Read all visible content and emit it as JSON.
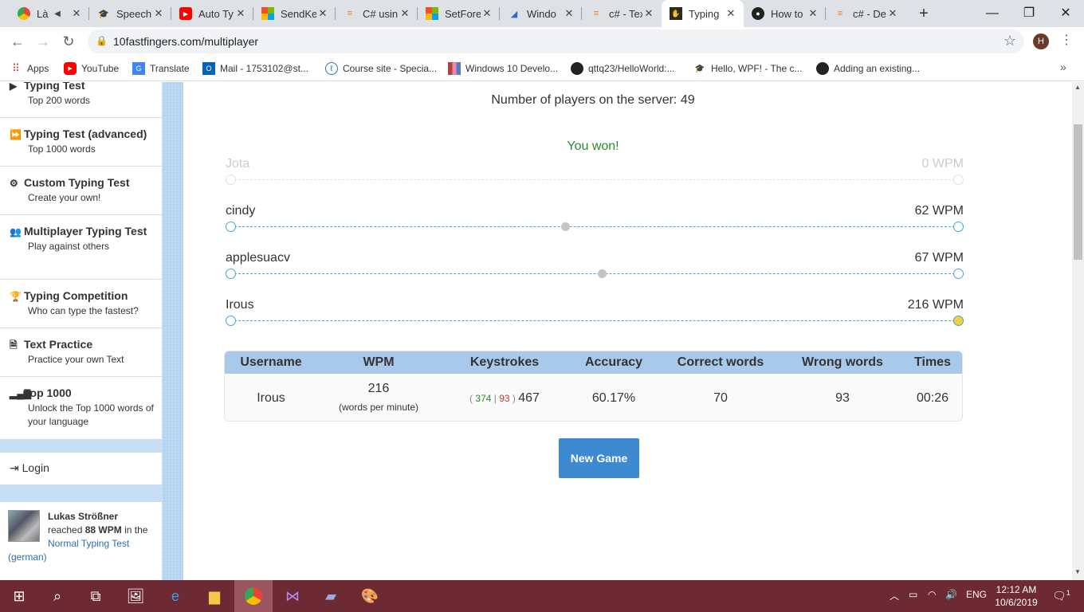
{
  "tabs": [
    {
      "title": "Là l",
      "icon": "chrome-icon",
      "active": false
    },
    {
      "title": "Speech",
      "icon": "graduation-cap-icon",
      "active": false
    },
    {
      "title": "Auto Ty",
      "icon": "youtube-icon",
      "active": false
    },
    {
      "title": "SendKe",
      "icon": "microsoft-icon",
      "active": false
    },
    {
      "title": "C# usin",
      "icon": "stackoverflow-icon",
      "active": false
    },
    {
      "title": "SetFore",
      "icon": "microsoft-icon",
      "active": false
    },
    {
      "title": "Windo",
      "icon": "visual-studio-icon",
      "active": false
    },
    {
      "title": "c# - Tex",
      "icon": "stackoverflow-icon",
      "active": false
    },
    {
      "title": "Typing",
      "icon": "10fastfingers-icon",
      "active": true
    },
    {
      "title": "How to",
      "icon": "github-icon",
      "active": false
    },
    {
      "title": "c# - De",
      "icon": "stackoverflow-icon",
      "active": false
    }
  ],
  "address": {
    "url": "10fastfingers.com/multiplayer"
  },
  "profile_initial": "H",
  "bookmarks": [
    {
      "label": "Apps",
      "icon": "apps-grid-icon"
    },
    {
      "label": "YouTube",
      "icon": "youtube-icon"
    },
    {
      "label": "Translate",
      "icon": "google-translate-icon"
    },
    {
      "label": "Mail - 1753102@st...",
      "icon": "outlook-icon"
    },
    {
      "label": "Course site - Specia...",
      "icon": "course-site-icon"
    },
    {
      "label": "Windows 10 Develo...",
      "icon": "book-icon"
    },
    {
      "label": "qttq23/HelloWorld:...",
      "icon": "github-icon"
    },
    {
      "label": "Hello, WPF! - The c...",
      "icon": "graduation-cap-icon"
    },
    {
      "label": "Adding an existing...",
      "icon": "github-icon"
    }
  ],
  "sidebar": {
    "menu": [
      {
        "title": "Typing Test",
        "sub": "Top 200 words",
        "icon": "play-icon"
      },
      {
        "title": "Typing Test (advanced)",
        "sub": "Top 1000 words",
        "icon": "fast-forward-icon"
      },
      {
        "title": "Custom Typing Test",
        "sub": "Create your own!",
        "icon": "cogs-icon"
      },
      {
        "title": "Multiplayer Typing Test",
        "sub": "Play against others",
        "icon": "users-icon"
      },
      {
        "title": "Typing Competition",
        "sub": "Who can type the fastest?",
        "icon": "trophy-icon"
      },
      {
        "title": "Text Practice",
        "sub": "Practice your own Text",
        "icon": "document-icon"
      },
      {
        "title": "Top 1000",
        "sub": "Unlock the Top 1000 words of your language",
        "icon": "bar-chart-icon"
      }
    ],
    "login": "Login",
    "news": {
      "name": "Lukas Strößner",
      "text1": "reached",
      "wpm": "88 WPM",
      "text2": "in the",
      "link": "Normal Typing Test (german)"
    }
  },
  "main": {
    "players_count": "Number of players on the server: 49",
    "result_message": "You won!",
    "racers": [
      {
        "name": "Jota",
        "wpm": "0 WPM",
        "progress": 0,
        "faded": true,
        "winner": false
      },
      {
        "name": "cindy",
        "wpm": "62 WPM",
        "progress": 0.46,
        "faded": false,
        "winner": false
      },
      {
        "name": "applesuacv",
        "wpm": "67 WPM",
        "progress": 0.51,
        "faded": false,
        "winner": false
      },
      {
        "name": "Irous",
        "wpm": "216 WPM",
        "progress": 1.0,
        "faded": false,
        "winner": true
      }
    ],
    "results_table": {
      "headers": [
        "Username",
        "WPM",
        "Keystrokes",
        "Accuracy",
        "Correct words",
        "Wrong words",
        "Times"
      ],
      "row": {
        "username": "Irous",
        "wpm": "216",
        "wpm_unit": "(words per minute)",
        "keystrokes_correct": "374",
        "keystrokes_wrong": "93",
        "keystrokes_total": "467",
        "accuracy": "60.17%",
        "correct_words": "70",
        "wrong_words": "93",
        "time": "00:26"
      }
    },
    "new_game_label": "New Game"
  },
  "taskbar": {
    "apps": [
      "windows-start-icon",
      "search-icon",
      "task-view-icon",
      "image-viewer-icon",
      "edge-icon",
      "file-explorer-icon",
      "chrome-icon",
      "visual-studio-icon",
      "notes-icon",
      "paint-icon"
    ],
    "language": "ENG",
    "time": "12:12 AM",
    "date": "10/6/2019",
    "notification_count": "1"
  },
  "colors": {
    "accent": "#3d8ad0",
    "won": "#2e8b2e",
    "winner_marker": "#f4d03f",
    "table_header": "#a9c9ea",
    "taskbar": "#6e2a33"
  }
}
